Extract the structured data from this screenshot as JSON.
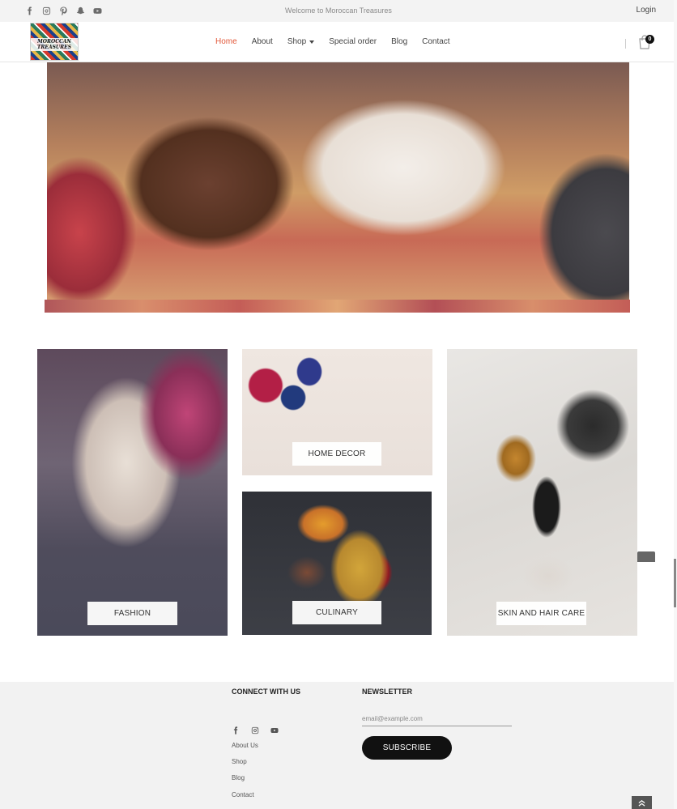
{
  "topbar": {
    "social": [
      "facebook-icon",
      "instagram-icon",
      "pinterest-icon",
      "snapchat-icon",
      "youtube-icon"
    ],
    "welcome": "Welcome to Moroccan Treasures",
    "login": "Login"
  },
  "header": {
    "logo_text": "MOROCCAN TREASURES",
    "nav": [
      {
        "label": "Home",
        "active": true
      },
      {
        "label": "About",
        "active": false
      },
      {
        "label": "Shop",
        "active": false
      },
      {
        "label": "Special order",
        "active": false
      },
      {
        "label": "Blog",
        "active": false
      },
      {
        "label": "Contact",
        "active": false
      }
    ],
    "cart_count": "0",
    "accent_color": "#e2583a"
  },
  "categories": {
    "fashion": "FASHION",
    "home_decor": "HOME DECOR",
    "culinary": "CULINARY",
    "skin_hair": "SKIN AND HAIR CARE"
  },
  "footer": {
    "connect_title": "CONNECT WITH US",
    "newsletter_title": "NEWSLETTER",
    "social": [
      "facebook-icon",
      "instagram-icon",
      "youtube-icon"
    ],
    "links": [
      "About Us",
      "Shop",
      "Blog",
      "Contact"
    ],
    "email_placeholder": "email@example.com",
    "subscribe": "SUBSCRIBE"
  }
}
